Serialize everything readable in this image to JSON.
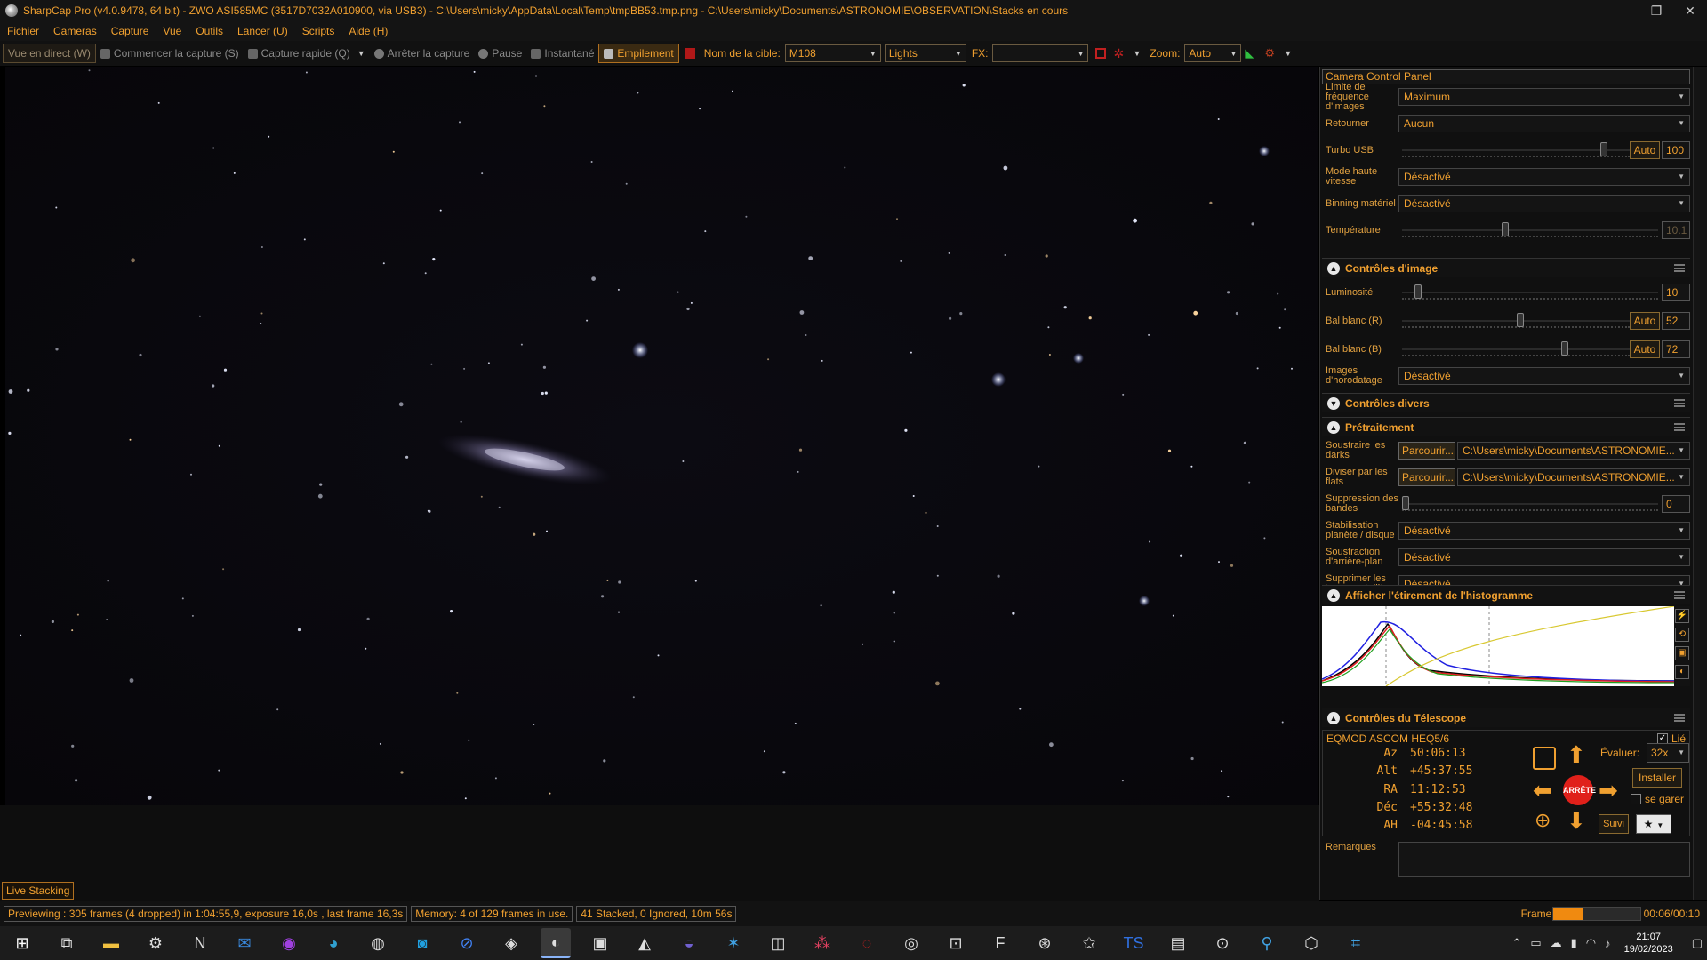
{
  "window": {
    "title": "SharpCap Pro (v4.0.9478, 64 bit) - ZWO ASI585MC (3517D7032A010900, via USB3) - C:\\Users\\micky\\AppData\\Local\\Temp\\tmpBB53.tmp.png - C:\\Users\\micky\\Documents\\ASTRONOMIE\\OBSERVATION\\Stacks en cours",
    "minimize": "—",
    "restore": "❐",
    "close": "✕"
  },
  "menu": [
    "Fichier",
    "Cameras",
    "Capture",
    "Vue",
    "Outils",
    "Lancer (U)",
    "Scripts",
    "Aide (H)"
  ],
  "toolbar": {
    "live_view": "Vue en direct (W)",
    "start_capture": "Commencer la capture (S)",
    "quick_capture": "Capture rapide (Q)",
    "stop_capture": "Arrêter la capture",
    "pause": "Pause",
    "snapshot": "Instantané",
    "stacking": "Empilement",
    "target_label": "Nom de la cible:",
    "target_value": "M108",
    "frame_type": "Lights",
    "fx_label": "FX:",
    "fx_value": "",
    "zoom_label": "Zoom:",
    "zoom_value": "Auto"
  },
  "panel": {
    "title": "Camera Control Panel",
    "camera_rows": [
      {
        "label": "Limite de fréquence d'images",
        "value": "Maximum"
      },
      {
        "label": "Retourner",
        "value": "Aucun"
      }
    ],
    "turbo_usb": {
      "label": "Turbo USB",
      "auto": "Auto",
      "value": "100",
      "level": 0.9
    },
    "mode_rows": [
      {
        "label": "Mode haute vitesse",
        "value": "Désactivé"
      },
      {
        "label": "Binning matériel",
        "value": "Désactivé"
      }
    ],
    "temperature": {
      "label": "Température",
      "value": "10.1",
      "level": 0.4
    },
    "image_controls": {
      "header": "Contrôles d'image",
      "luminosite": {
        "label": "Luminosité",
        "value": "10",
        "level": 0.05
      },
      "wb_r": {
        "label": "Bal blanc (R)",
        "auto": "Auto",
        "value": "52",
        "level": 0.52
      },
      "wb_b": {
        "label": "Bal blanc (B)",
        "auto": "Auto",
        "value": "72",
        "level": 0.72
      },
      "timestamp": {
        "label": "Images d'horodatage",
        "value": "Désactivé"
      }
    },
    "misc_header": "Contrôles divers",
    "preprocessing": {
      "header": "Prétraitement",
      "darks": {
        "label": "Soustraire les darks",
        "browse": "Parcourir...",
        "path": "C:\\Users\\micky\\Documents\\ASTRONOMIE..."
      },
      "flats": {
        "label": "Diviser par les flats",
        "browse": "Parcourir...",
        "path": "C:\\Users\\micky\\Documents\\ASTRONOMIE..."
      },
      "banding": {
        "label": "Suppression des bandes",
        "value": "0",
        "level": 0.0
      },
      "rows": [
        {
          "label": "Stabilisation planète / disque",
          "value": "Désactivé"
        },
        {
          "label": "Soustraction d'arrière-plan",
          "value": "Désactivé"
        },
        {
          "label": "Supprimer les traces satellites",
          "value": "Désactivé"
        }
      ]
    },
    "histogram_header": "Afficher l'étirement de l'histogramme",
    "telescope": {
      "header": "Contrôles du Télescope",
      "mount": "EQMOD ASCOM HEQ5/6",
      "linked_label": "Lié",
      "linked": true,
      "coords": [
        {
          "key": "Az",
          "value": "50:06:13"
        },
        {
          "key": "Alt",
          "value": "+45:37:55"
        },
        {
          "key": "RA",
          "value": "11:12:53"
        },
        {
          "key": "Déc",
          "value": "+55:32:48"
        },
        {
          "key": "AH",
          "value": "-04:45:58"
        }
      ],
      "stop": "ARRÊTE",
      "rate_label": "Évaluer:",
      "rate_value": "32x",
      "install": "Installer",
      "park_label": "se garer",
      "track": "Suivi"
    },
    "remarks_label": "Remarques"
  },
  "live_stacking_tab": "Live Stacking",
  "status": {
    "preview": "Previewing : 305 frames (4 dropped) in 1:04:55,9, exposure 16,0s , last frame 16,3s",
    "memory": "Memory: 4 of 129 frames in use.",
    "stacked": "41 Stacked, 0 Ignored, 10m 56s",
    "frame_label": "Frame :",
    "frame_progress": 0.35,
    "frame_time": "00:06/00:10"
  },
  "taskbar": {
    "time": "21:07",
    "date": "19/02/2023"
  },
  "colors": {
    "accent": "#f0a030",
    "background": "#101010",
    "stop": "#e0201a"
  }
}
